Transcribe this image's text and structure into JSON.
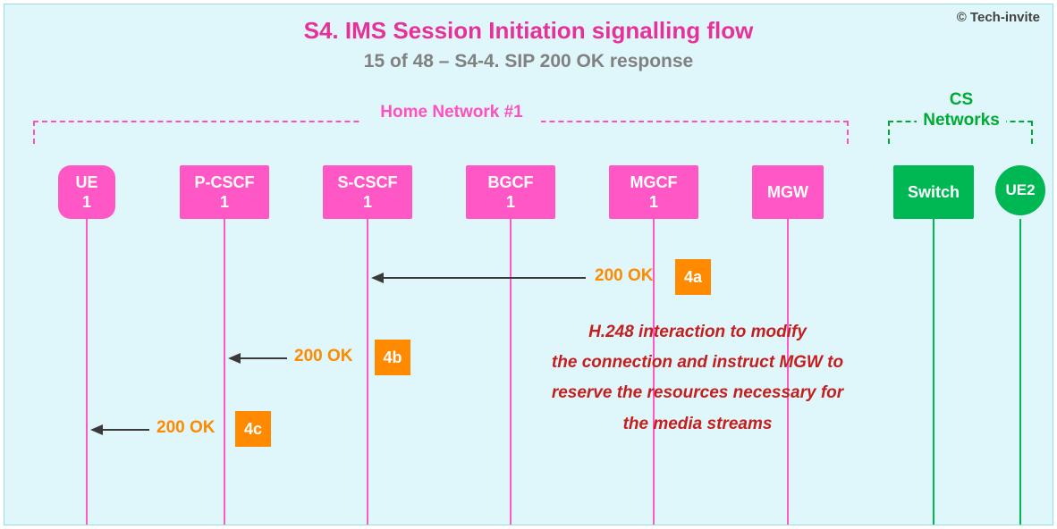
{
  "copyright": "© Tech-invite",
  "title": "S4. IMS Session Initiation signalling flow",
  "subtitle": "15 of 48 – S4-4. SIP 200 OK response",
  "groups": {
    "home": "Home Network #1",
    "cs": "CS\nNetworks"
  },
  "nodes": {
    "ue1": "UE\n1",
    "pcscf": "P-CSCF\n1",
    "scscf": "S-CSCF\n1",
    "bgcf": "BGCF\n1",
    "mgcf": "MGCF\n1",
    "mgw": "MGW",
    "switch": "Switch",
    "ue2": "UE2"
  },
  "messages": {
    "m4a": {
      "label": "200 OK",
      "step": "4a"
    },
    "m4b": {
      "label": "200 OK",
      "step": "4b"
    },
    "m4c": {
      "label": "200 OK",
      "step": "4c"
    }
  },
  "note": "H.248 interaction to modify\nthe connection and instruct MGW to\nreserve the resources necessary for\nthe media streams"
}
